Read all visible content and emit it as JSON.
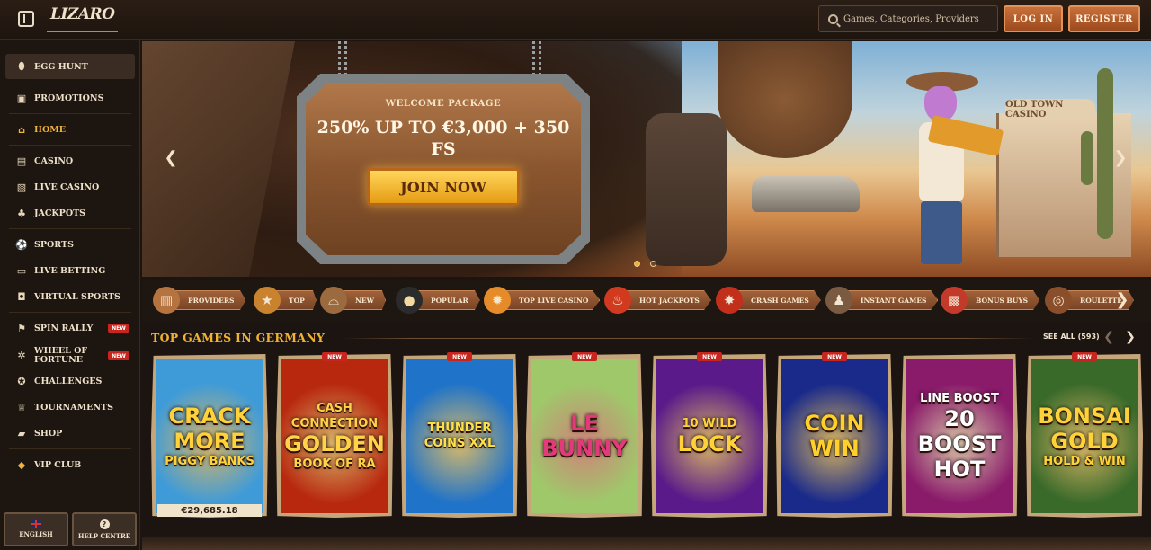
{
  "header": {
    "logo_text": "LIZARO",
    "search_placeholder": "Games, Categories, Providers",
    "login_label": "LOG IN",
    "register_label": "REGISTER"
  },
  "sidebar": {
    "items": [
      {
        "label": "EGG HUNT",
        "icon": "egg-icon"
      },
      {
        "label": "PROMOTIONS",
        "icon": "gift-icon"
      },
      {
        "label": "HOME",
        "icon": "home-icon"
      },
      {
        "label": "CASINO",
        "icon": "slot-machine-icon"
      },
      {
        "label": "LIVE CASINO",
        "icon": "cards-icon"
      },
      {
        "label": "JACKPOTS",
        "icon": "clover-icon"
      },
      {
        "label": "SPORTS",
        "icon": "soccer-ball-icon"
      },
      {
        "label": "LIVE BETTING",
        "icon": "tv-icon"
      },
      {
        "label": "VIRTUAL SPORTS",
        "icon": "vr-icon"
      },
      {
        "label": "SPIN RALLY",
        "icon": "rally-icon",
        "badge": "NEW"
      },
      {
        "label": "WHEEL OF FORTUNE",
        "icon": "wheel-icon",
        "badge": "NEW"
      },
      {
        "label": "CHALLENGES",
        "icon": "medal-icon"
      },
      {
        "label": "TOURNAMENTS",
        "icon": "trophy-icon"
      },
      {
        "label": "SHOP",
        "icon": "shopping-bag-icon"
      },
      {
        "label": "VIP CLUB",
        "icon": "diamond-icon"
      }
    ],
    "language_label": "ENGLISH",
    "help_label": "HELP CENTRE"
  },
  "banner": {
    "subtitle": "WELCOME PACKAGE",
    "title": "250% UP TO €3,000 + 350 FS",
    "cta": "JOIN NOW",
    "sign_text": "OLD TOWN CASINO",
    "slide_count": 2,
    "active_slide": 1
  },
  "categories": [
    {
      "label": "PROVIDERS",
      "icon": "provider-icon",
      "color": "#b5743f"
    },
    {
      "label": "TOP",
      "icon": "star-badge-icon",
      "color": "#c9832f"
    },
    {
      "label": "NEW",
      "icon": "cowboy-hat-icon",
      "color": "#9b6a3f"
    },
    {
      "label": "POPULAR",
      "icon": "bomb-icon",
      "color": "#2b2b2b"
    },
    {
      "label": "TOP LIVE CASINO",
      "icon": "chip-icon",
      "color": "#e58b2a"
    },
    {
      "label": "HOT JACKPOTS",
      "icon": "chili-icon",
      "color": "#d23a20"
    },
    {
      "label": "CRASH GAMES",
      "icon": "dynamite-icon",
      "color": "#c2301c"
    },
    {
      "label": "INSTANT GAMES",
      "icon": "joystick-icon",
      "color": "#7a5a40"
    },
    {
      "label": "BONUS BUYS",
      "icon": "gift-box-icon",
      "color": "#c43a2a"
    },
    {
      "label": "ROULETTE",
      "icon": "roulette-icon",
      "color": "#8a4e2a"
    }
  ],
  "top_games": {
    "title": "TOP GAMES IN GERMANY",
    "see_all": "SEE ALL (593)",
    "games": [
      {
        "title": "CRACK MORE PIGGY BANKS",
        "lines": [
          "CRACK",
          "MORE",
          "PIGGY BANKS"
        ],
        "badge": "",
        "jackpot": "€29,685.18",
        "bg": "#3f9bd8",
        "fg": "#ffd23a"
      },
      {
        "title": "CASH CONNECTION GOLDEN BOOK OF RA",
        "lines": [
          "CASH CONNECTION",
          "GOLDEN",
          "BOOK OF RA"
        ],
        "badge": "NEW",
        "jackpot": "",
        "bg": "#b8280f",
        "fg": "#ffd24a"
      },
      {
        "title": "THUNDER COINS XXL",
        "lines": [
          "THUNDER",
          "COINS XXL"
        ],
        "badge": "NEW",
        "jackpot": "",
        "bg": "#1f73c9",
        "fg": "#ffe04a"
      },
      {
        "title": "LE BUNNY",
        "lines": [
          "LE",
          "BUNNY"
        ],
        "badge": "NEW",
        "jackpot": "",
        "bg": "#9fc86a",
        "fg": "#e23a7a"
      },
      {
        "title": "10 WILD LOCK",
        "lines": [
          "10 WILD",
          "LOCK"
        ],
        "badge": "NEW",
        "jackpot": "",
        "bg": "#5a1a8a",
        "fg": "#ffd23a"
      },
      {
        "title": "COIN WIN",
        "lines": [
          "COIN",
          "WIN"
        ],
        "badge": "NEW",
        "jackpot": "",
        "bg": "#1a2a8a",
        "fg": "#ffcf2a"
      },
      {
        "title": "20 BOOST HOT",
        "lines": [
          "LINE BOOST",
          "20",
          "BOOST",
          "HOT"
        ],
        "badge": "",
        "jackpot": "",
        "bg": "#8a1a6a",
        "fg": "#ffffff"
      },
      {
        "title": "BONSAI GOLD HOLD & WIN",
        "lines": [
          "BONSAI",
          "GOLD",
          "HOLD & WIN"
        ],
        "badge": "NEW",
        "jackpot": "",
        "bg": "#3a6a2a",
        "fg": "#ffd23a"
      }
    ]
  }
}
